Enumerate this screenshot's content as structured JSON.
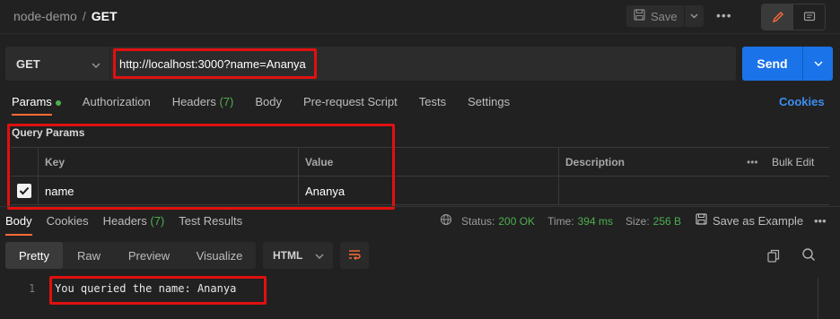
{
  "breadcrumb": {
    "collection": "node-demo",
    "separator": "/",
    "request": "GET"
  },
  "topbar": {
    "save_label": "Save",
    "more_label": "•••"
  },
  "request": {
    "method": "GET",
    "url": "http://localhost:3000?name=Ananya",
    "send_label": "Send"
  },
  "request_tabs": [
    {
      "label": "Params",
      "active": true
    },
    {
      "label": "Authorization"
    },
    {
      "label": "Headers",
      "count": "(7)"
    },
    {
      "label": "Body"
    },
    {
      "label": "Pre-request Script"
    },
    {
      "label": "Tests"
    },
    {
      "label": "Settings"
    }
  ],
  "cookies_label": "Cookies",
  "query_params": {
    "title": "Query Params",
    "headers": {
      "key": "Key",
      "value": "Value",
      "description": "Description",
      "more": "•••",
      "bulk_edit": "Bulk Edit"
    },
    "rows": [
      {
        "checked": true,
        "key": "name",
        "value": "Ananya",
        "description": ""
      }
    ]
  },
  "response_tabs": [
    {
      "label": "Body",
      "active": true
    },
    {
      "label": "Cookies"
    },
    {
      "label": "Headers",
      "count": "(7)"
    },
    {
      "label": "Test Results"
    }
  ],
  "response_meta": {
    "status_label": "Status:",
    "status_value": "200 OK",
    "time_label": "Time:",
    "time_value": "394 ms",
    "size_label": "Size:",
    "size_value": "256 B",
    "save_example_label": "Save as Example",
    "more_label": "•••"
  },
  "view_modes": [
    {
      "label": "Pretty",
      "active": true
    },
    {
      "label": "Raw"
    },
    {
      "label": "Preview"
    },
    {
      "label": "Visualize"
    }
  ],
  "format": "HTML",
  "response_body": {
    "line_number": "1",
    "text": "You queried the name: Ananya"
  },
  "colors": {
    "accent": "#ff6c37",
    "send": "#1a73e8",
    "status_ok": "#4caf50",
    "highlight_box": "#e01010",
    "link": "#3d8ef0"
  }
}
